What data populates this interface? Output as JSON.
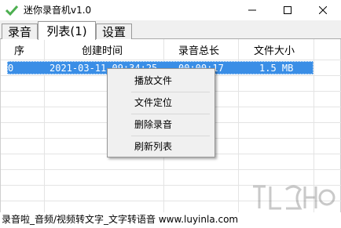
{
  "window": {
    "title": "迷你录音机v1.0",
    "minimize_glyph": "—",
    "maximize_glyph": "☐",
    "close_glyph": "✕"
  },
  "tabs": [
    {
      "label": "录音",
      "selected": false
    },
    {
      "label": "列表(1)",
      "selected": true
    },
    {
      "label": "设置",
      "selected": false
    }
  ],
  "table": {
    "columns": [
      "序",
      "创建时间",
      "录音总长",
      "文件大小"
    ],
    "rows": [
      {
        "index": "0",
        "created": "2021-03-11 09:34:25",
        "duration": "00:00:17",
        "size": "1.5 MB",
        "selected": true
      }
    ]
  },
  "context_menu": {
    "items": [
      "播放文件",
      "文件定位",
      "删除录音",
      "刷新列表"
    ]
  },
  "footer": {
    "text": "录音啦_音频/视频转文字_文字转语音 www.luyinla.com"
  },
  "colors": {
    "selection": "#3a8ee6",
    "app_icon": "#4caf50"
  },
  "icons": {
    "app": "check-shield-icon"
  }
}
